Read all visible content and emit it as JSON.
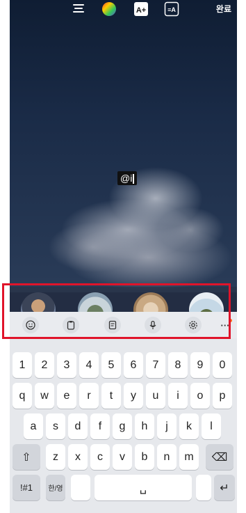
{
  "topbar": {
    "icons": [
      "align-icon",
      "color-wheel-icon",
      "text-effect-icon",
      "text-style-icon"
    ],
    "text_effect_label": "A+",
    "text_style_label": "≡A",
    "done_label": "완료"
  },
  "canvas": {
    "mention_text": "@i"
  },
  "suggestions": {
    "avatars": [
      "avatar-1",
      "avatar-2",
      "avatar-3",
      "avatar-4"
    ]
  },
  "toolbar": {
    "icons": [
      "emoji-icon",
      "clipboard-icon",
      "notes-icon",
      "microphone-icon",
      "settings-icon",
      "more-icon"
    ],
    "more_label": "···"
  },
  "keyboard": {
    "numbers": [
      "1",
      "2",
      "3",
      "4",
      "5",
      "6",
      "7",
      "8",
      "9",
      "0"
    ],
    "row1": [
      "q",
      "w",
      "e",
      "r",
      "t",
      "y",
      "u",
      "i",
      "o",
      "p"
    ],
    "row2": [
      "a",
      "s",
      "d",
      "f",
      "g",
      "h",
      "j",
      "k",
      "l"
    ],
    "row3": [
      "z",
      "x",
      "c",
      "v",
      "b",
      "n",
      "m"
    ],
    "symbols_label": "!#1",
    "lang_label": "한/영",
    "shift_label": "⇧",
    "backspace_label": "⌫",
    "enter_label": "↵",
    "space_label": "␣"
  },
  "colors": {
    "highlight": "#e0142a",
    "keyboard_bg": "#e6e8ec"
  }
}
